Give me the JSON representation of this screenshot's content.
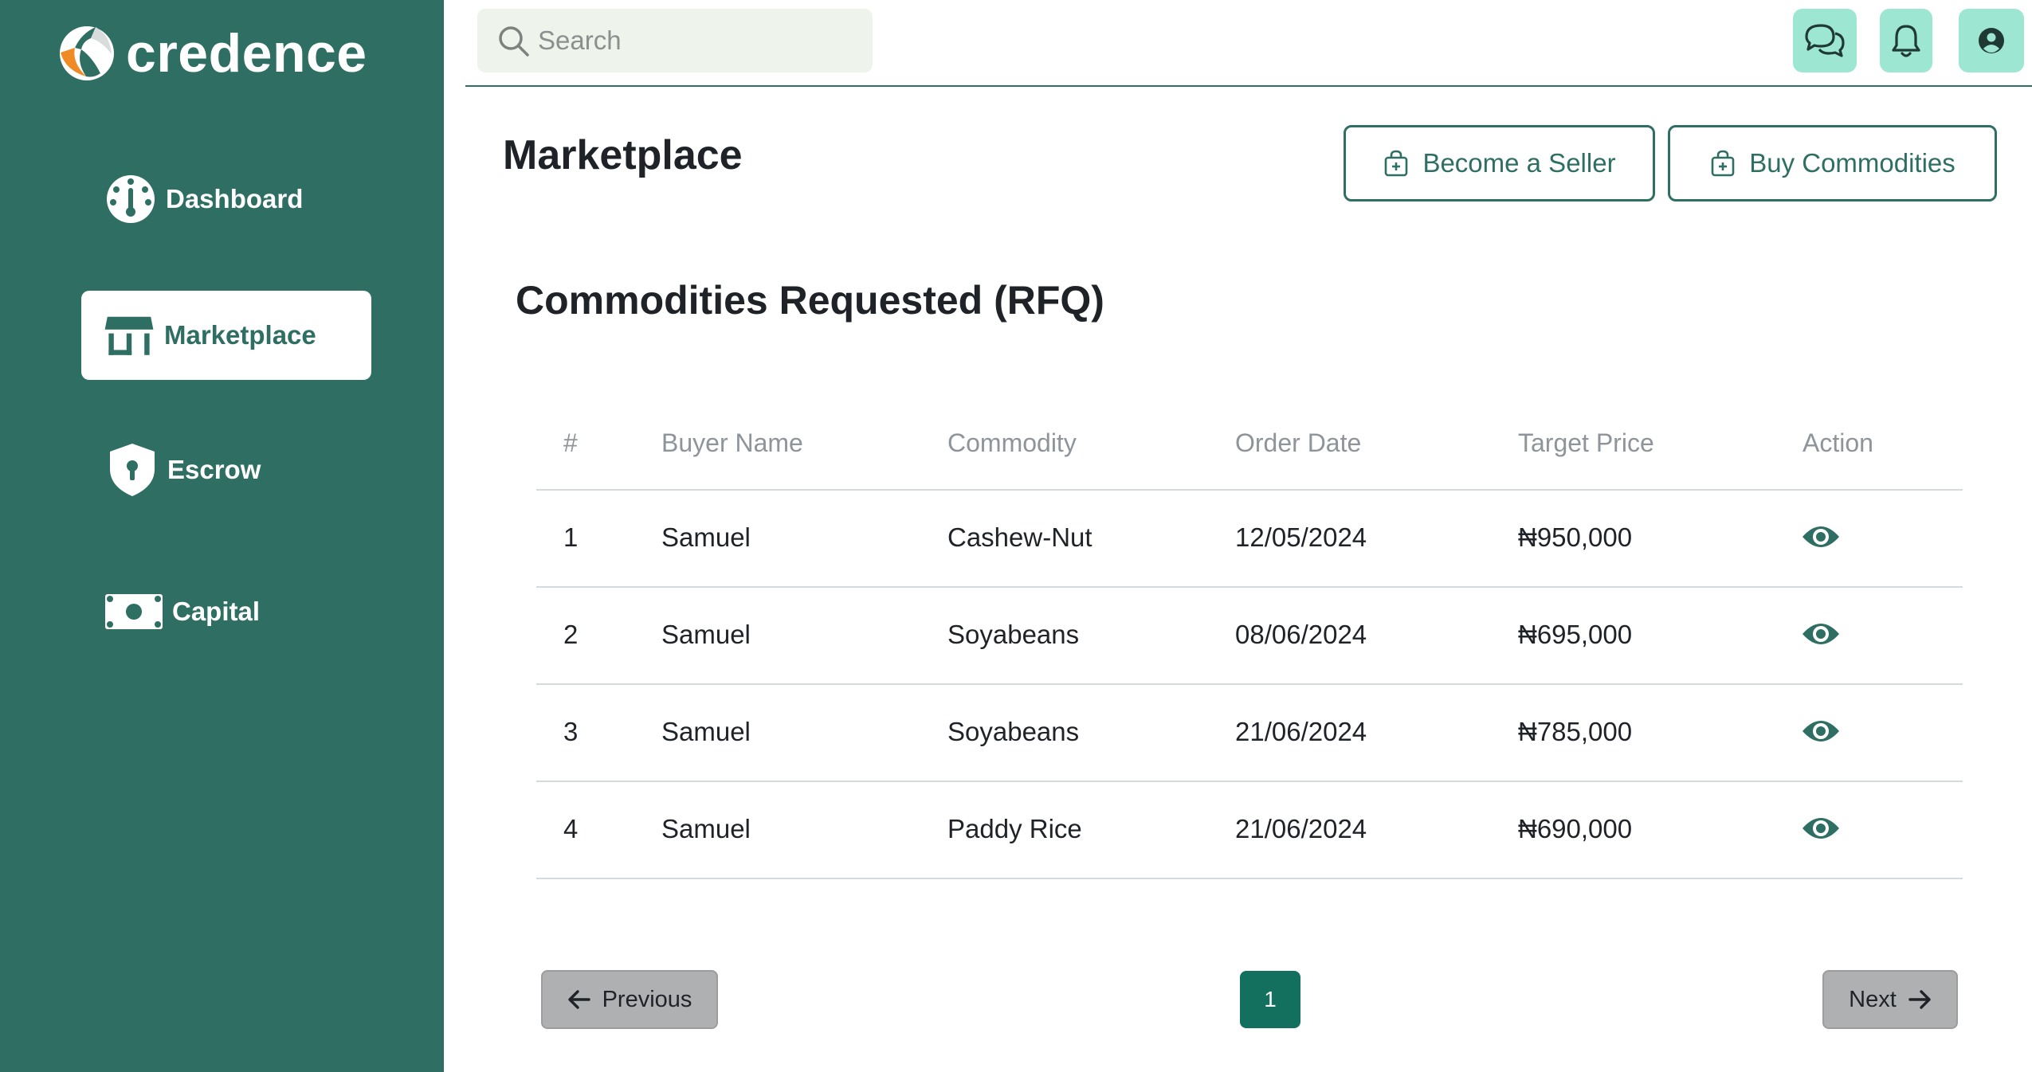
{
  "brand": {
    "name": "credence"
  },
  "sidebar": {
    "items": [
      {
        "label": "Dashboard",
        "icon": "dashboard-icon"
      },
      {
        "label": "Marketplace",
        "icon": "store-icon",
        "active": true
      },
      {
        "label": "Escrow",
        "icon": "shield-lock-icon"
      },
      {
        "label": "Capital",
        "icon": "cash-icon"
      }
    ]
  },
  "topbar": {
    "search_placeholder": "Search",
    "icons": [
      "chat-icon",
      "bell-icon",
      "user-icon"
    ]
  },
  "main": {
    "title": "Marketplace",
    "become_seller_label": "Become a Seller",
    "buy_commodities_label": "Buy Commodities",
    "section_title": "Commodities Requested (RFQ)"
  },
  "table": {
    "headers": [
      "#",
      "Buyer Name",
      "Commodity",
      "Order Date",
      "Target Price",
      "Action"
    ],
    "rows": [
      {
        "num": "1",
        "buyer": "Samuel",
        "commodity": "Cashew-Nut",
        "date": "12/05/2024",
        "price": "₦950,000"
      },
      {
        "num": "2",
        "buyer": "Samuel",
        "commodity": "Soyabeans",
        "date": "08/06/2024",
        "price": "₦695,000"
      },
      {
        "num": "3",
        "buyer": "Samuel",
        "commodity": "Soyabeans",
        "date": "21/06/2024",
        "price": "₦785,000"
      },
      {
        "num": "4",
        "buyer": "Samuel",
        "commodity": "Paddy Rice",
        "date": "21/06/2024",
        "price": "₦690,000"
      }
    ]
  },
  "pagination": {
    "previous_label": "Previous",
    "current_page": "1",
    "next_label": "Next"
  },
  "colors": {
    "sidebar": "#2f6f63",
    "accent": "#14705e",
    "icon_button_bg": "#9de6d2",
    "logo_orange": "#f08a24"
  }
}
